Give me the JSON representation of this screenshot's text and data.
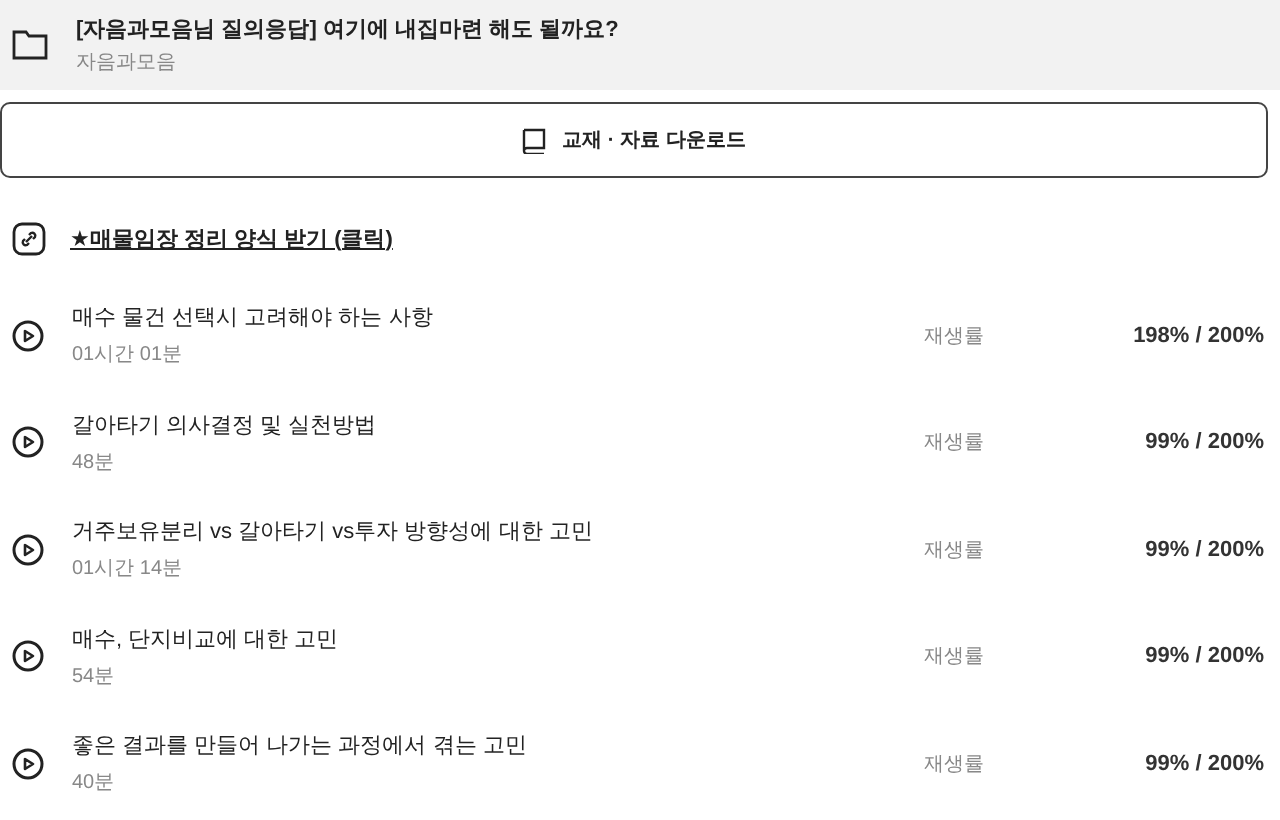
{
  "header": {
    "title": "[자음과모음님 질의응답] 여기에 내집마련 해도 될까요?",
    "subtitle": "자음과모음"
  },
  "download_button": {
    "label": "교재 · 자료 다운로드"
  },
  "link": {
    "label": "★매물임장 정리 양식 받기 (클릭)"
  },
  "lessons": [
    {
      "title": "매수 물건 선택시 고려해야 하는 사항",
      "duration": "01시간 01분",
      "rate_label": "재생률",
      "rate": "198% / 200%"
    },
    {
      "title": "갈아타기 의사결정 및 실천방법",
      "duration": "48분",
      "rate_label": "재생률",
      "rate": "99% / 200%"
    },
    {
      "title": "거주보유분리 vs 갈아타기 vs투자 방향성에 대한 고민",
      "duration": "01시간 14분",
      "rate_label": "재생률",
      "rate": "99% / 200%"
    },
    {
      "title": "매수, 단지비교에 대한 고민",
      "duration": "54분",
      "rate_label": "재생률",
      "rate": "99% / 200%"
    },
    {
      "title": "좋은 결과를 만들어 나가는 과정에서 겪는 고민",
      "duration": "40분",
      "rate_label": "재생률",
      "rate": "99% / 200%"
    }
  ]
}
